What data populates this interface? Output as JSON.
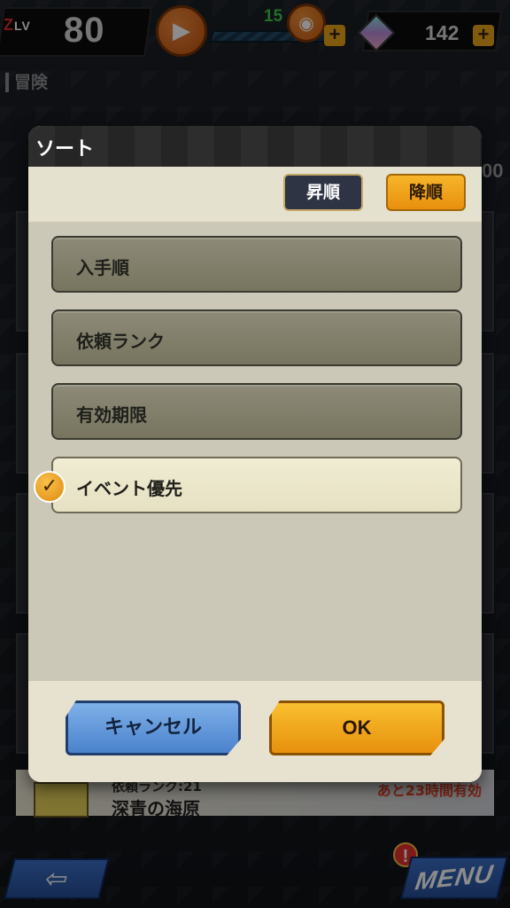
{
  "hud": {
    "level_tag": "Z",
    "level_tag_suffix": "LV",
    "level": "80",
    "stamina": "15",
    "gems": "142"
  },
  "background": {
    "section_label": "冒険",
    "right_number": "00",
    "bottom_card": {
      "rank": "依頼ランク:21",
      "name": "深青の海原",
      "time_left": "あと23時間有効"
    }
  },
  "modal": {
    "title": "ソート",
    "ascending_label": "昇順",
    "descending_label": "降順",
    "options": [
      {
        "label": "入手順",
        "selected": false
      },
      {
        "label": "依頼ランク",
        "selected": false
      },
      {
        "label": "有効期限",
        "selected": false
      },
      {
        "label": "イベント優先",
        "selected": true
      }
    ],
    "cancel_label": "キャンセル",
    "ok_label": "OK"
  },
  "nav": {
    "menu_label": "MENU"
  },
  "colors": {
    "accent_orange": "#e8900e",
    "accent_blue": "#4a82cc",
    "selected_bg": "#e6e1c3",
    "option_bg": "#77755f"
  },
  "icons": {
    "video": "video-camera-icon",
    "camera": "camera-icon",
    "gem": "gem-icon",
    "check": "check-icon",
    "back": "arrow-left-icon",
    "alert": "exclamation-icon"
  }
}
